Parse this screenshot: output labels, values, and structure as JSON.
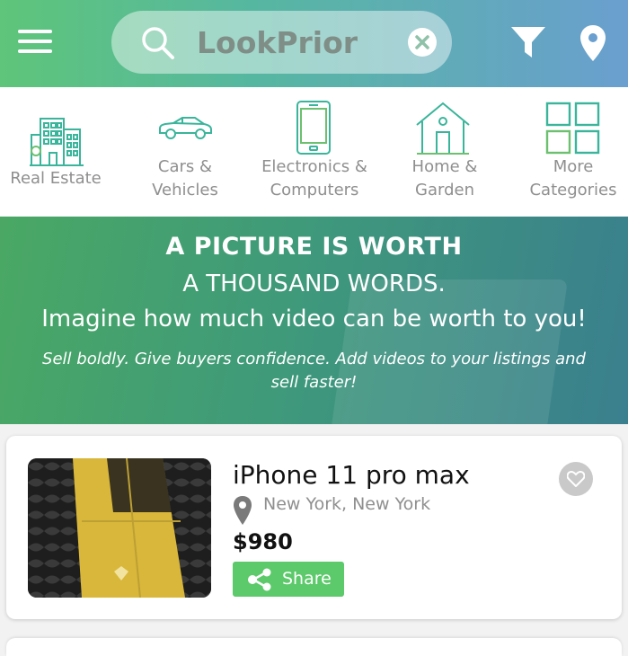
{
  "header": {
    "search_value": "LookPrior",
    "icons": [
      "menu-icon",
      "search-icon",
      "clear-icon",
      "filter-icon",
      "location-pin-icon"
    ]
  },
  "categories": [
    {
      "label": "Real Estate",
      "icon": "building-icon"
    },
    {
      "label": "Cars &\nVehicles",
      "icon": "car-icon"
    },
    {
      "label": "Electronics &\nComputers",
      "icon": "phone-icon"
    },
    {
      "label": "Home &\nGarden",
      "icon": "house-icon"
    },
    {
      "label": "More\nCategories",
      "icon": "grid-icon"
    }
  ],
  "banner": {
    "title": "A PICTURE IS WORTH",
    "line1": "A THOUSAND WORDS.",
    "line2": "Imagine how much video can be worth to you!",
    "note": "Sell boldly. Give buyers confidence. Add videos to your listings and sell faster!"
  },
  "listing": {
    "title": "iPhone 11 pro max",
    "location": "New York, New York",
    "price": "$980",
    "share_label": "Share"
  },
  "colors": {
    "header_start": "#5ec57a",
    "header_end": "#6a9fcf",
    "category_icon": "#3ab59b",
    "share_button": "#5cc96a"
  }
}
